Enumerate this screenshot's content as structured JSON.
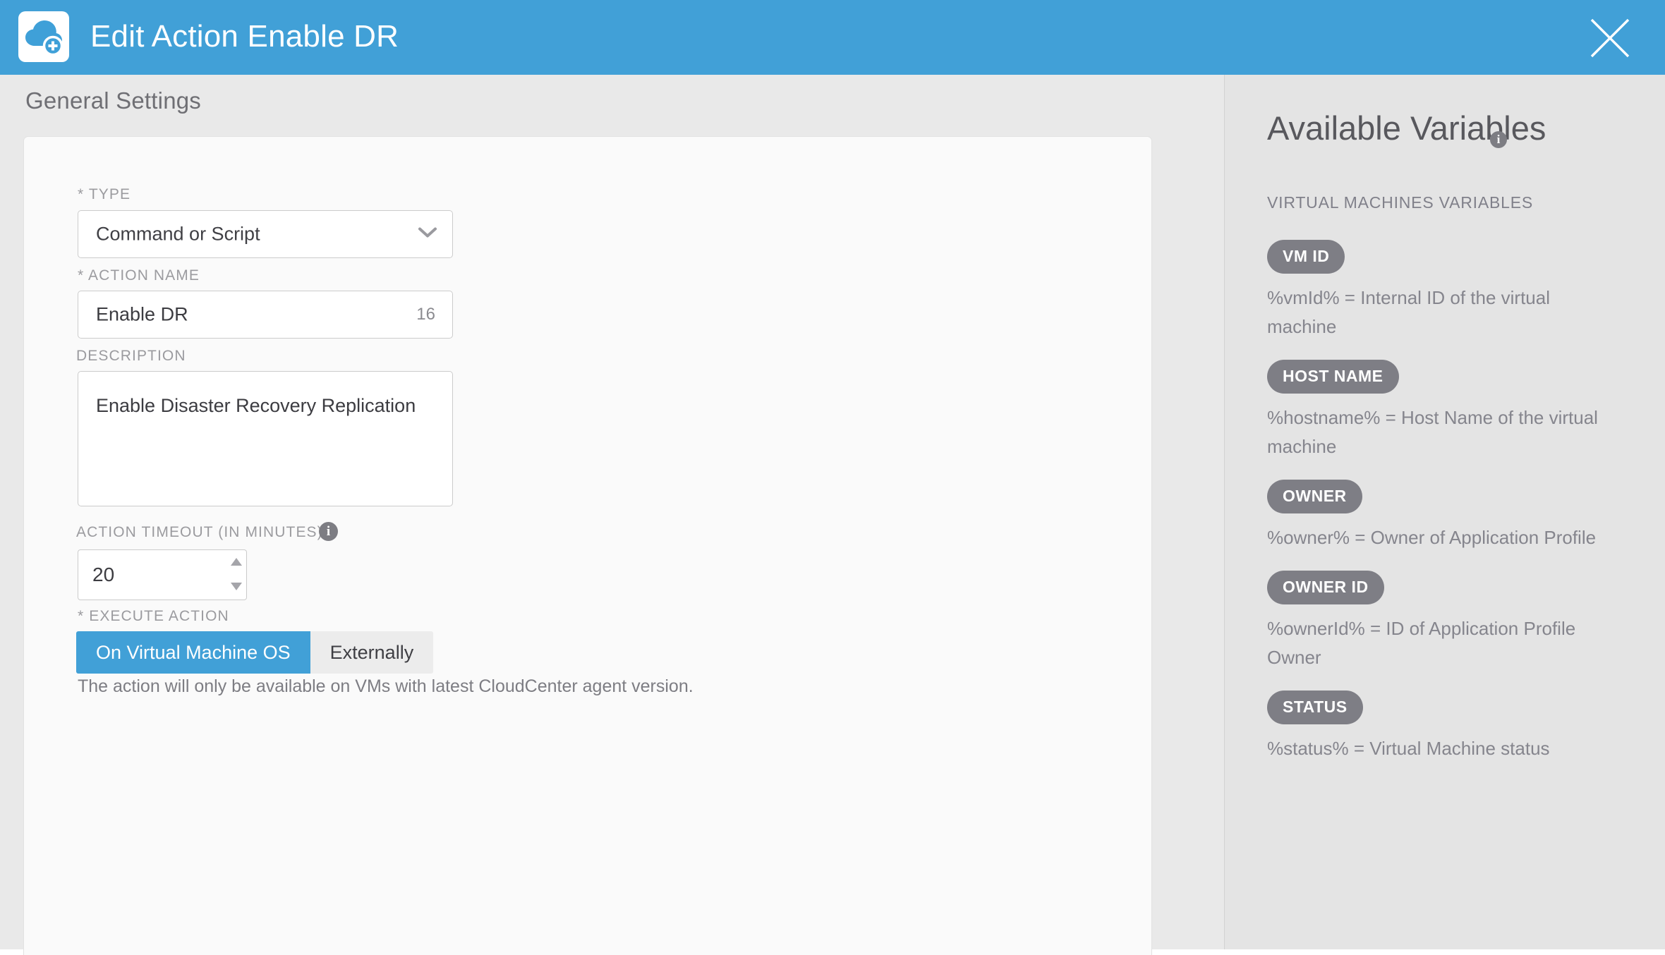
{
  "header": {
    "title": "Edit Action Enable DR",
    "icon": "cloud-add-icon",
    "close_label": "×",
    "background": "#41A0D7"
  },
  "left": {
    "section_title": "General Settings",
    "fields": {
      "type": {
        "label": "* TYPE",
        "value": "Command or Script",
        "options": [
          "Command or Script"
        ]
      },
      "action_name": {
        "label": "* ACTION NAME",
        "value": "Enable DR",
        "counter": "16"
      },
      "description": {
        "label": "DESCRIPTION",
        "value": "Enable Disaster Recovery Replication"
      },
      "action_timeout": {
        "label": "ACTION TIMEOUT (IN MINUTES)",
        "value": "20",
        "info": "i"
      },
      "execute_action": {
        "label": "* EXECUTE ACTION",
        "options": [
          {
            "label": "On Virtual Machine OS",
            "active": true
          },
          {
            "label": "Externally",
            "active": false
          }
        ],
        "hint": "The action will only be available on VMs with latest CloudCenter agent version."
      }
    }
  },
  "right": {
    "title": "Available Variables",
    "title_info": "i",
    "subtitle": "VIRTUAL MACHINES VARIABLES",
    "variables": [
      {
        "badge": "VM ID",
        "desc": "%vmId% = Internal ID of the virtual machine"
      },
      {
        "badge": "HOST NAME",
        "desc": "%hostname% = Host Name of the virtual machine"
      },
      {
        "badge": "OWNER",
        "desc": "%owner% = Owner of Application Profile"
      },
      {
        "badge": "OWNER ID",
        "desc": "%ownerId% = ID of Application Profile Owner"
      },
      {
        "badge": "STATUS",
        "desc": "%status% = Virtual Machine status"
      }
    ]
  },
  "colors": {
    "accent": "#41A0D7",
    "badge_gray": "#7E7E85",
    "page_bg": "#E8E8E8",
    "card_bg": "#FAFAFA"
  }
}
